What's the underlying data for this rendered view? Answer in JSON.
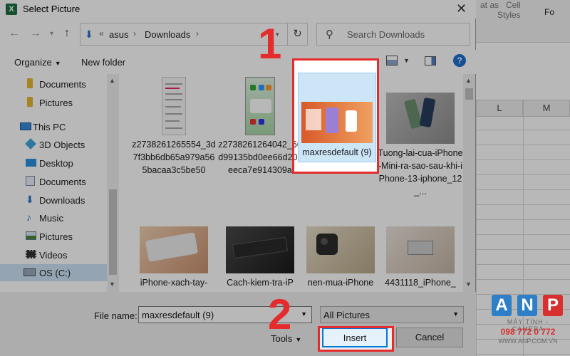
{
  "excel": {
    "ribbon_partial_1": "at as",
    "ribbon_partial_2": "Cell",
    "ribbon_partial_3": "Styles",
    "ribbon_partial_4": "Fo",
    "columns": [
      "L",
      "M"
    ]
  },
  "dialog": {
    "title": "Select Picture",
    "address": {
      "segments": [
        "asus",
        "Downloads"
      ],
      "prefix": "«"
    },
    "search": {
      "placeholder": "Search Downloads"
    },
    "toolbar": {
      "organize": "Organize",
      "new_folder": "New folder"
    },
    "nav": [
      {
        "label": "Documents",
        "icon": "folder-icon"
      },
      {
        "label": "Pictures",
        "icon": "folder-icon"
      },
      {
        "label": "This PC",
        "icon": "computer-icon"
      },
      {
        "label": "3D Objects",
        "icon": "cube-icon"
      },
      {
        "label": "Desktop",
        "icon": "desktop-icon"
      },
      {
        "label": "Documents",
        "icon": "documents-icon"
      },
      {
        "label": "Downloads",
        "icon": "download-icon"
      },
      {
        "label": "Music",
        "icon": "music-icon"
      },
      {
        "label": "Pictures",
        "icon": "pictures-icon"
      },
      {
        "label": "Videos",
        "icon": "videos-icon"
      },
      {
        "label": "OS (C:)",
        "icon": "drive-icon"
      }
    ],
    "files": [
      {
        "name": "z2738261265554_3d7f3bb6db65a979a565bacaa3c5be50"
      },
      {
        "name": "z2738261264042_66d99135bd0ee66d20ceeca7e914309a"
      },
      {
        "name": "maxresdefault (9)"
      },
      {
        "name": "Tuong-lai-cua-iPhone-Mini-ra-sao-sau-khi-iPhone-13-iphone_12_..."
      },
      {
        "name": "iPhone-xach-tay-"
      },
      {
        "name": "Cach-kiem-tra-iP"
      },
      {
        "name": "nen-mua-iPhone"
      },
      {
        "name": "4431118_iPhone_"
      }
    ],
    "file_name_label": "File name:",
    "file_name_value": "maxresdefault (9)",
    "file_type": "All Pictures",
    "tools": "Tools",
    "insert": "Insert",
    "cancel": "Cancel"
  },
  "annotations": {
    "step1": "1",
    "step2": "2"
  },
  "logo": {
    "letters": [
      "A",
      "N",
      "P"
    ],
    "tagline": "MÁY TÍNH - CAMERA",
    "phone": "098 772 0 772",
    "website": "WWW.ANP.COM.VN"
  },
  "colors": {
    "annotation_red": "#e52b2b",
    "selection_blue": "#cce6f8",
    "anp_blue": "#2f7fc8",
    "anp_red": "#d9302f"
  }
}
